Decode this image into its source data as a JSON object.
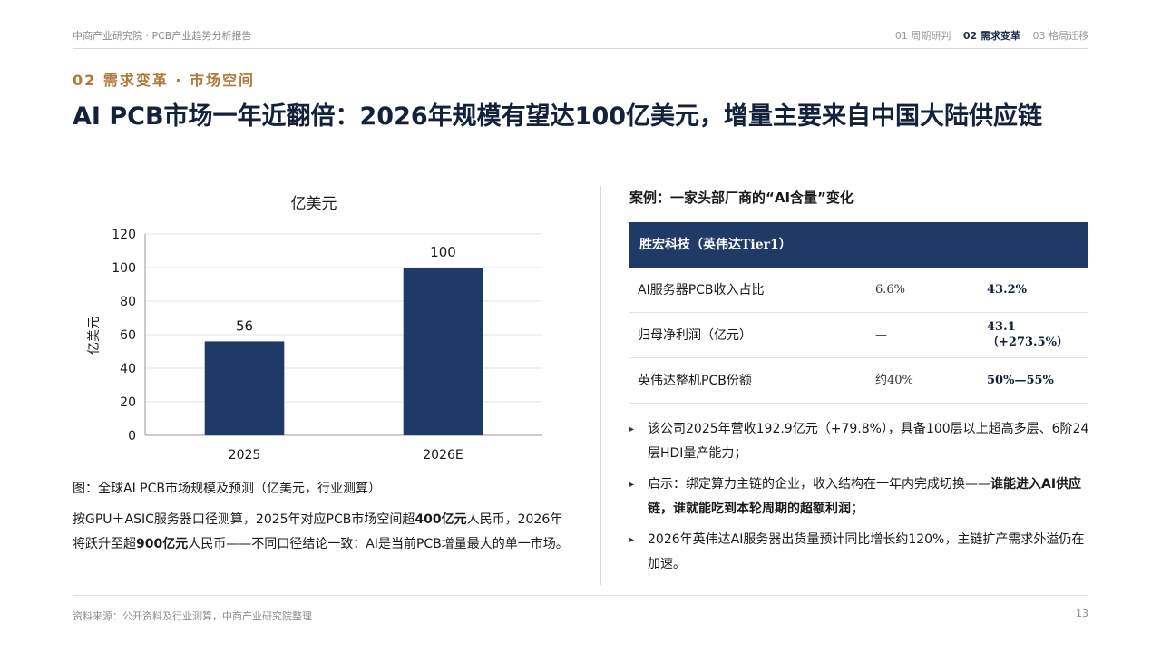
{
  "header": {
    "doc_title": "中商产业研究院 · PCB产业趋势分析报告",
    "nav": [
      {
        "label": "01 周期研判",
        "active": false
      },
      {
        "label": "02 需求变革",
        "active": true
      },
      {
        "label": "03 格局迁移",
        "active": false
      }
    ]
  },
  "section_label": "02 需求变革 · 市场空间",
  "headline": "AI PCB市场一年近翻倍：2026年规模有望达100亿美元，增量主要来自中国大陆供应链",
  "chart_data": {
    "type": "bar",
    "title": "亿美元",
    "ylabel": "亿美元",
    "xlabel": "",
    "categories": [
      "2025",
      "2026E"
    ],
    "values": [
      56,
      100
    ],
    "data_labels": [
      "56",
      "100"
    ],
    "ylim": [
      0,
      120
    ],
    "yticks": [
      "0",
      "20",
      "40",
      "60",
      "80",
      "100",
      "120"
    ],
    "grid": true,
    "bar_color": "#1f3a66"
  },
  "figure": {
    "caption": "图：全球AI PCB市场规模及预测（亿美元，行业测算）",
    "note_part1": "按GPU＋ASIC服务器口径测算，2025年对应PCB市场空间超",
    "note_bold1": "400亿元",
    "note_part2": "人民币，2026年将跃升至超",
    "note_bold2": "900亿元",
    "note_part3": "人民币——不同口径结论一致：AI是当前PCB增量最大的单一市场。"
  },
  "case": {
    "title": "案例：一家头部厂商的“AI含量”变化",
    "table_header": "胜宏科技（英伟达Tier1）",
    "rows": [
      {
        "label": "AI服务器PCB收入占比",
        "before": "6.6%",
        "after": "43.2%",
        "after2": ""
      },
      {
        "label": "归母净利润（亿元）",
        "before": "—",
        "after": "43.1",
        "after2": "（+273.5%）"
      },
      {
        "label": "英伟达整机PCB份额",
        "before": "约40%",
        "after": "50%—55%",
        "after2": ""
      }
    ]
  },
  "bullets": {
    "marker": "▸",
    "b1": "该公司2025年营收192.9亿元（+79.8%），具备100层以上超高多层、6阶24层HDI量产能力；",
    "b2_plain": "启示：绑定算力主链的企业，收入结构在一年内完成切换——",
    "b2_bold": "谁能进入AI供应链，谁就能吃到本轮周期的超额利润；",
    "b3": "2026年英伟达AI服务器出货量预计同比增长约120%，主链扩产需求外溢仍在加速。"
  },
  "footer": {
    "source": "资料来源：公开资料及行业测算，中商产业研究院整理",
    "page": "13"
  }
}
